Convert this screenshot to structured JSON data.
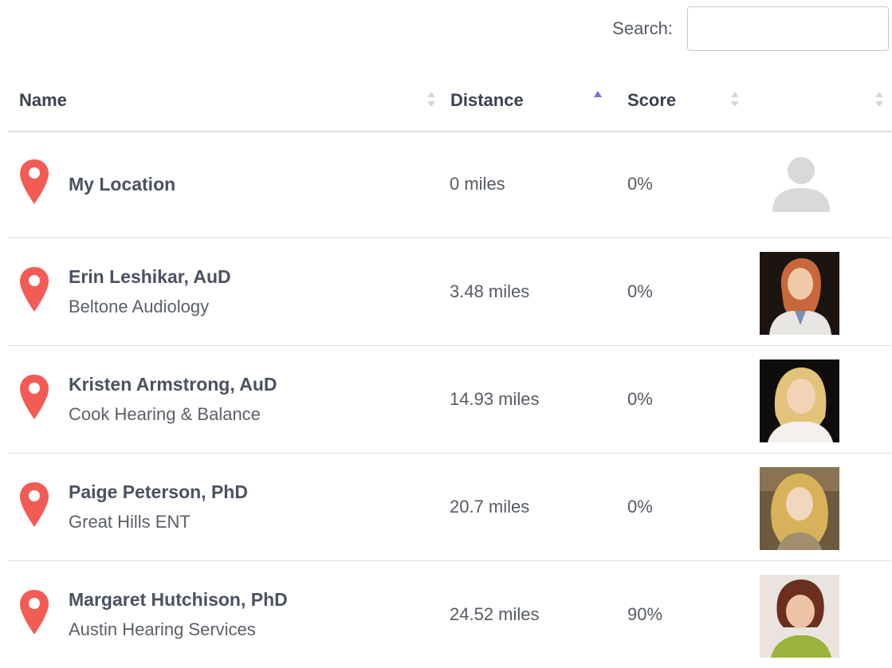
{
  "search": {
    "label": "Search:",
    "value": "",
    "placeholder": ""
  },
  "columns": {
    "name": "Name",
    "distance": "Distance",
    "score": "Score",
    "photo": ""
  },
  "sort": {
    "active_column": "distance",
    "direction": "ascending"
  },
  "colors": {
    "pin": "#f25c54",
    "sort_active": "#7a6fd6",
    "header_text": "#3a4250"
  },
  "rows": [
    {
      "icon": "map-pin-icon",
      "name": "My Location",
      "practice": "",
      "distance": "0 miles",
      "score": "0%",
      "photo": "placeholder-avatar-icon"
    },
    {
      "icon": "map-pin-icon",
      "name": "Erin Leshikar, AuD",
      "practice": "Beltone Audiology",
      "distance": "3.48 miles",
      "score": "0%",
      "photo": "profile-photo"
    },
    {
      "icon": "map-pin-icon",
      "name": "Kristen Armstrong, AuD",
      "practice": "Cook Hearing & Balance",
      "distance": "14.93 miles",
      "score": "0%",
      "photo": "profile-photo"
    },
    {
      "icon": "map-pin-icon",
      "name": "Paige Peterson, PhD",
      "practice": "Great Hills ENT",
      "distance": "20.7 miles",
      "score": "0%",
      "photo": "profile-photo"
    },
    {
      "icon": "map-pin-icon",
      "name": "Margaret Hutchison, PhD",
      "practice": "Austin Hearing Services",
      "distance": "24.52 miles",
      "score": "90%",
      "photo": "profile-photo"
    }
  ]
}
